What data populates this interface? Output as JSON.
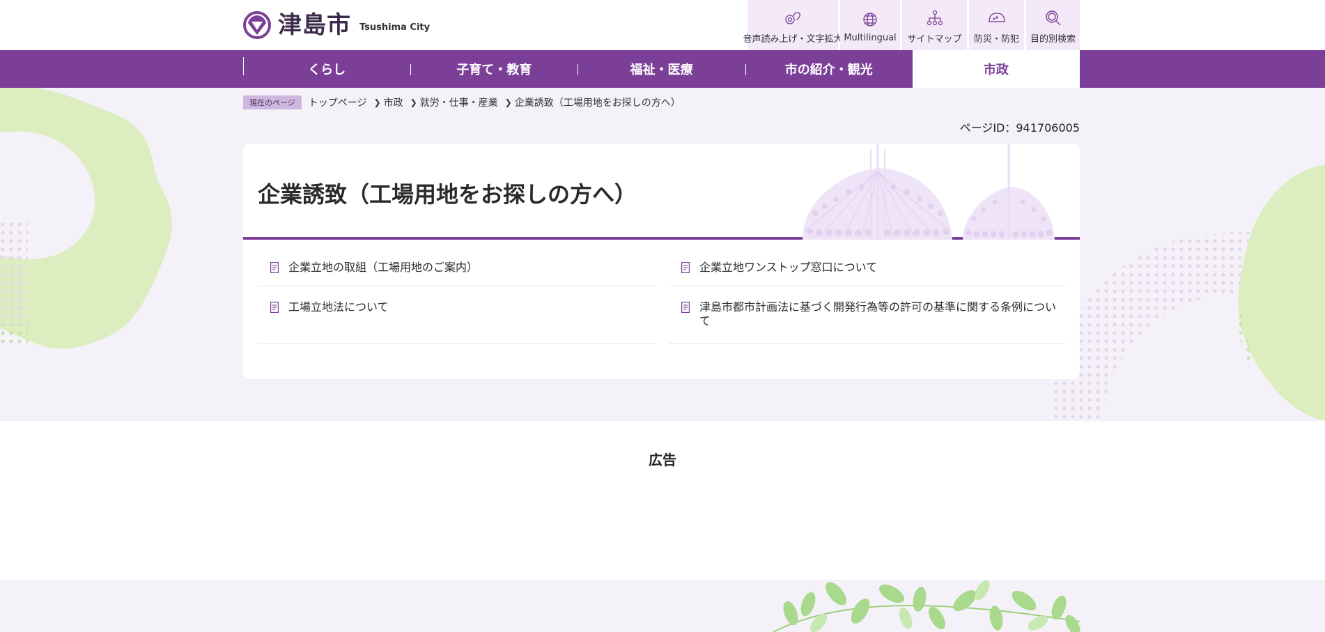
{
  "header": {
    "logo_jp": "津島市",
    "logo_en": "Tsushima City",
    "utility": [
      {
        "label": "音声読み上げ・文字拡大",
        "icon": "speech-icon"
      },
      {
        "label": "Multilingual",
        "icon": "globe-icon"
      },
      {
        "label": "サイトマップ",
        "icon": "sitemap-icon"
      },
      {
        "label": "防災・防犯",
        "icon": "disaster-icon"
      },
      {
        "label": "目的別検索",
        "icon": "search-icon"
      }
    ]
  },
  "nav": {
    "items": [
      {
        "label": "くらし"
      },
      {
        "label": "子育て・教育"
      },
      {
        "label": "福祉・医療"
      },
      {
        "label": "市の紹介・観光"
      },
      {
        "label": "市政",
        "active": true
      }
    ]
  },
  "breadcrumb": {
    "label": "現在のページ",
    "items": [
      "トップページ",
      "市政",
      "就労・仕事・産業",
      "企業誘致（工場用地をお探しの方へ）"
    ]
  },
  "page_id": "ページID：941706005",
  "main": {
    "title": "企業誘致（工場用地をお探しの方へ）",
    "links": [
      {
        "label": "企業立地の取組（工場用地のご案内）"
      },
      {
        "label": "企業立地ワンストップ窓口について"
      },
      {
        "label": "工場立地法について"
      },
      {
        "label": "津島市都市計画法に基づく開発行為等の許可の基準に関する条例について"
      }
    ]
  },
  "ads": {
    "title": "広告"
  },
  "colors": {
    "brand_purple": "#7b3f98",
    "light_bg": "#f5f1f9",
    "util_bg": "#f3e9f8",
    "deco_green": "#dcedbf"
  }
}
